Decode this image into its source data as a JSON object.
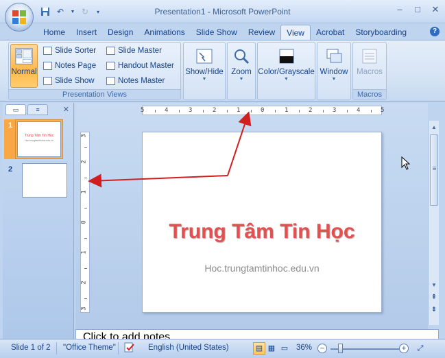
{
  "window": {
    "title": "Presentation1 - Microsoft PowerPoint",
    "minimize": "–",
    "restore": "□",
    "close": "✕"
  },
  "tabs": [
    "Home",
    "Insert",
    "Design",
    "Animations",
    "Slide Show",
    "Review",
    "View",
    "Acrobat",
    "Storyboarding"
  ],
  "active_tab": "View",
  "ribbon": {
    "presentation_views": {
      "label": "Presentation Views",
      "normal": "Normal",
      "slide_sorter": "Slide Sorter",
      "notes_page": "Notes Page",
      "slide_show": "Slide Show",
      "slide_master": "Slide Master",
      "handout_master": "Handout Master",
      "notes_master": "Notes Master"
    },
    "show_hide": "Show/Hide",
    "zoom": "Zoom",
    "color_grayscale": "Color/Grayscale",
    "window": "Window",
    "macros": "Macros",
    "macros_group_label": "Macros"
  },
  "slides_pane": {
    "slides": [
      {
        "number": "1",
        "title": "Trung Tâm Tin Học",
        "subtitle": "Hoc.trungtamtinhoc.edu.vn"
      },
      {
        "number": "2",
        "title": "",
        "subtitle": ""
      }
    ]
  },
  "hruler_labels": [
    "5",
    "4",
    "3",
    "2",
    "1",
    "0",
    "1",
    "2",
    "3",
    "4",
    "5"
  ],
  "vruler_labels": [
    "3",
    "2",
    "1",
    "0",
    "1",
    "2",
    "3"
  ],
  "slide": {
    "title": "Trung Tâm Tin Học",
    "subtitle": "Hoc.trungtamtinhoc.edu.vn"
  },
  "notes": {
    "placeholder": "Click to add notes"
  },
  "status": {
    "slide_counter": "Slide 1 of 2",
    "theme": "\"Office Theme\"",
    "language": "English (United States)",
    "zoom": "36%"
  },
  "colors": {
    "title_red": "#e35050",
    "annotation_red": "#d11e1e",
    "accent_orange": "#ffb84d"
  }
}
